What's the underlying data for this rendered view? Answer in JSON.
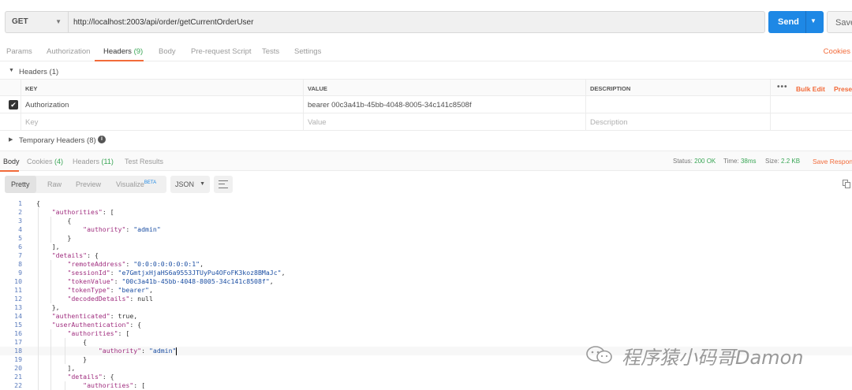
{
  "request": {
    "method": "GET",
    "url": "http://localhost:2003/api/order/getCurrentOrderUser",
    "send_label": "Send",
    "save_label": "Save"
  },
  "request_tabs": [
    {
      "label": "Params"
    },
    {
      "label": "Authorization"
    },
    {
      "label": "Headers",
      "count": "(9)"
    },
    {
      "label": "Body"
    },
    {
      "label": "Pre-request Script"
    },
    {
      "label": "Tests"
    },
    {
      "label": "Settings"
    }
  ],
  "cookies_link": "Cookies",
  "headers_section": {
    "title": "Headers (1)",
    "columns": {
      "key": "KEY",
      "value": "VALUE",
      "description": "DESCRIPTION"
    },
    "bulk_edit": "Bulk Edit",
    "presets": "Presets",
    "rows": [
      {
        "key": "Authorization",
        "value": "bearer 00c3a41b-45bb-4048-8005-34c141c8508f",
        "description": ""
      }
    ],
    "placeholder": {
      "key": "Key",
      "value": "Value",
      "description": "Description"
    }
  },
  "temporary_headers": "Temporary Headers (8)",
  "response_tabs": [
    {
      "label": "Body"
    },
    {
      "label": "Cookies",
      "count": "(4)"
    },
    {
      "label": "Headers",
      "count": "(11)"
    },
    {
      "label": "Test Results"
    }
  ],
  "response_meta": {
    "status_label": "Status:",
    "status": "200 OK",
    "time_label": "Time:",
    "time": "38ms",
    "size_label": "Size:",
    "size": "2.2 KB",
    "save_response": "Save Response"
  },
  "view_modes": {
    "pretty": "Pretty",
    "raw": "Raw",
    "preview": "Preview",
    "visualize": "Visualize",
    "beta": "BETA"
  },
  "format": "JSON",
  "code_lines": [
    "{",
    "    \"authorities\": [",
    "        {",
    "            \"authority\": \"admin\"",
    "        }",
    "    ],",
    "    \"details\": {",
    "        \"remoteAddress\": \"0:0:0:0:0:0:0:1\",",
    "        \"sessionId\": \"e7GmtjxHjaHS6a9553JTUyPu4OFoFK3koz8BMaJc\",",
    "        \"tokenValue\": \"00c3a41b-45bb-4048-8005-34c141c8508f\",",
    "        \"tokenType\": \"bearer\",",
    "        \"decodedDetails\": null",
    "    },",
    "    \"authenticated\": true,",
    "    \"userAuthentication\": {",
    "        \"authorities\": [",
    "            {",
    "                \"authority\": \"admin\"",
    "            }",
    "        ],",
    "        \"details\": {",
    "            \"authorities\": ["
  ],
  "watermark": "程序猿小码哥Damon"
}
